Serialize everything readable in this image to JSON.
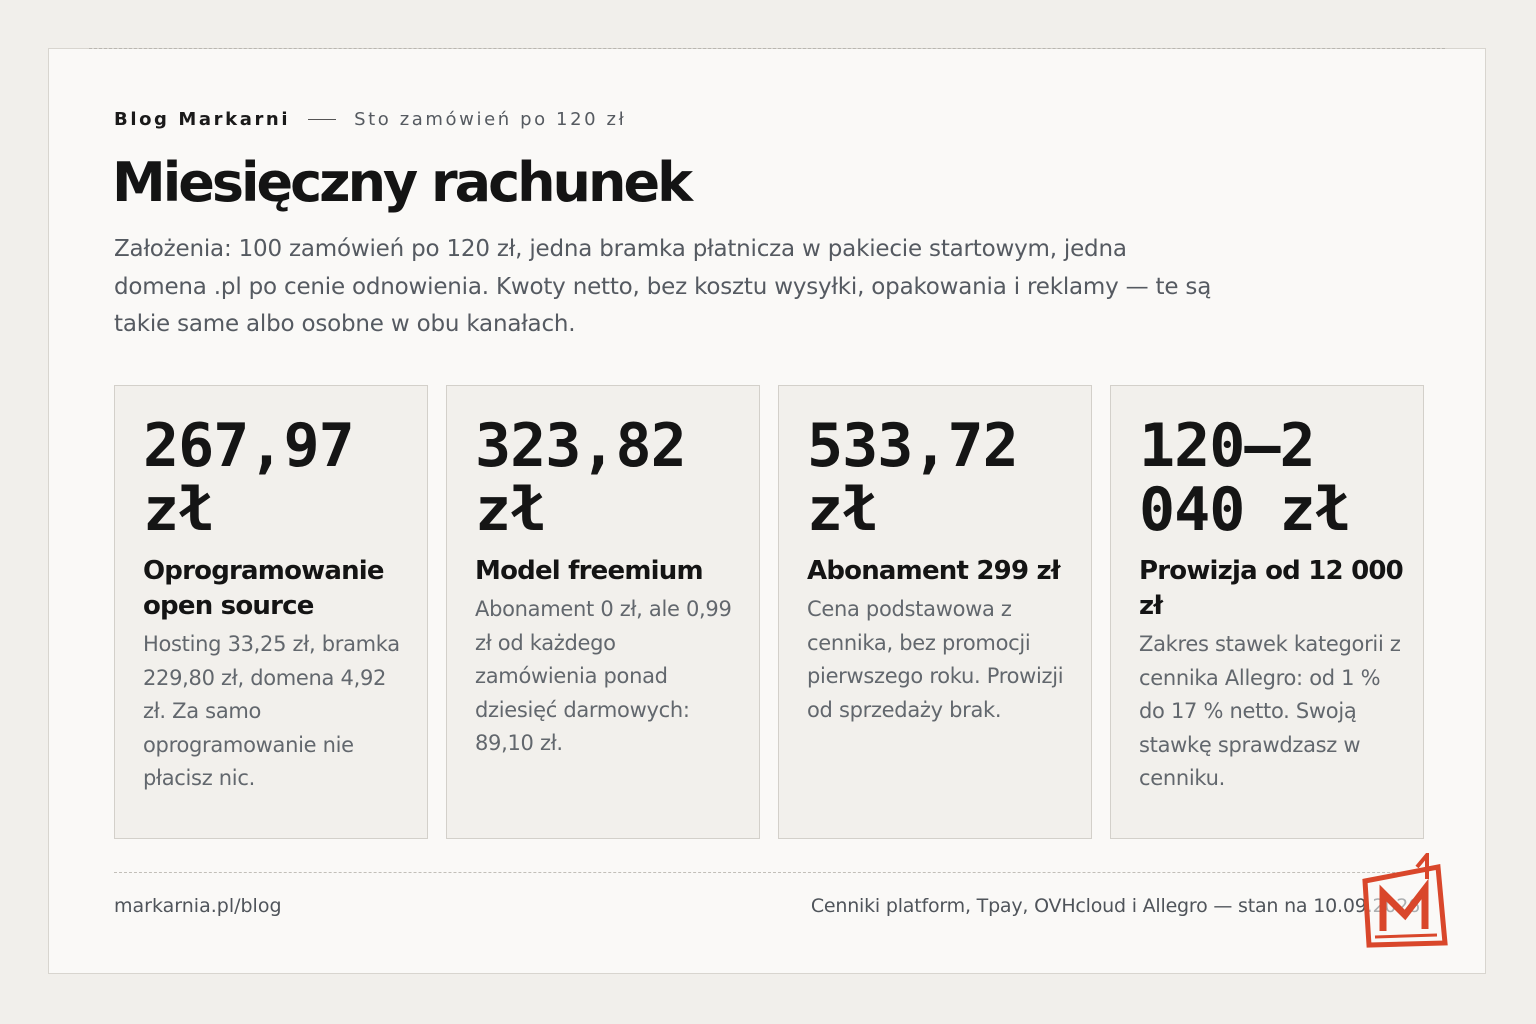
{
  "header": {
    "brand": "Blog Markarni",
    "series": "Sto zamówień po 120 zł",
    "title": "Miesięczny rachunek",
    "intro": "Założenia: 100 zamówień po 120 zł, jedna bramka płatnicza w pakiecie startowym, jedna domena .pl po cenie odnowienia. Kwoty netto, bez kosztu wysyłki, opakowania i reklamy — te są takie same albo osobne w obu kanałach."
  },
  "cards": [
    {
      "value": "267,97 zł",
      "title": "Oprogramowanie open source",
      "description": "Hosting 33,25 zł, bramka 229,80 zł, domena 4,92 zł. Za samo oprogramowanie nie płacisz nic."
    },
    {
      "value": "323,82 zł",
      "title": "Model freemium",
      "description": "Abonament 0 zł, ale 0,99 zł od każdego zamówienia ponad dziesięć darmowych: 89,10 zł."
    },
    {
      "value": "533,72 zł",
      "title": "Abonament 299 zł",
      "description": "Cena podstawowa z cennika, bez promocji pierwszego roku. Prowizji od sprzedaży brak."
    },
    {
      "value": "120–2 040 zł",
      "title": "Prowizja od 12 000 zł",
      "description": "Zakres stawek kategorii z cennika Allegro: od 1 % do 17 % netto. Swoją stawkę sprawdzasz w cenniku."
    }
  ],
  "footer": {
    "url": "markarnia.pl/blog",
    "sources": "Cenniki platform, Tpay, OVHcloud i Allegro — stan na 10.09.2026"
  },
  "colors": {
    "background": "#f1efeb",
    "card": "#faf9f7",
    "logo_accent": "#d9472b"
  },
  "logo": {
    "icon": "markarnia-m-logo"
  }
}
